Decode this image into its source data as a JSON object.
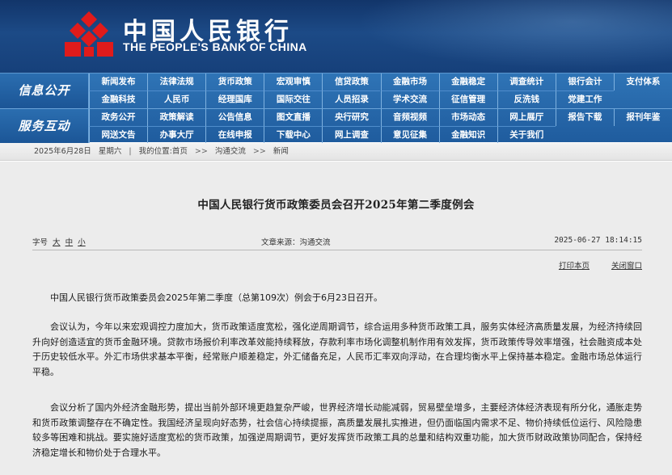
{
  "header": {
    "bank_name_cn": "中国人民银行",
    "bank_name_en": "THE PEOPLE'S BANK OF CHINA",
    "logo_icon": "pboc-emblem-icon",
    "colors": {
      "banner": "#1c4a86",
      "logo_red": "#e01b1b",
      "nav": "#2a69aa"
    }
  },
  "nav": {
    "groups": [
      {
        "title": "信息公开",
        "rows": [
          [
            "新闻发布",
            "法律法规",
            "货币政策",
            "宏观审慎",
            "信贷政策",
            "金融市场",
            "金融稳定",
            "调查统计",
            "银行会计",
            "支付体系"
          ],
          [
            "金融科技",
            "人民币",
            "经理国库",
            "国际交往",
            "人员招录",
            "学术交流",
            "征信管理",
            "反洗钱",
            "党建工作"
          ]
        ]
      },
      {
        "title": "服务互动",
        "rows": [
          [
            "政务公开",
            "政策解读",
            "公告信息",
            "图文直播",
            "央行研究",
            "音频视频",
            "市场动态",
            "网上展厅",
            "报告下载",
            "报刊年鉴"
          ],
          [
            "网送文告",
            "办事大厅",
            "在线申报",
            "下载中心",
            "网上调查",
            "意见征集",
            "金融知识",
            "关于我们"
          ]
        ]
      }
    ]
  },
  "breadcrumb": {
    "date": "2025年6月28日",
    "weekday": "星期六",
    "position_label": "我的位置:首页",
    "items": [
      "沟通交流",
      "新闻"
    ]
  },
  "article": {
    "title": "中国人民银行货币政策委员会召开2025年第二季度例会",
    "font_size_label": "字号",
    "font_sizes": [
      "大",
      "中",
      "小"
    ],
    "source": "文章来源：沟通交流",
    "published": "2025-06-27 18:14:15",
    "print_label": "打印本页",
    "close_label": "关闭窗口",
    "paragraphs": [
      "中国人民银行货币政策委员会2025年第二季度（总第109次）例会于6月23日召开。",
      "会议认为，今年以来宏观调控力度加大，货币政策适度宽松，强化逆周期调节，综合运用多种货币政策工具，服务实体经济高质量发展，为经济持续回升向好创造适宜的货币金融环境。贷款市场报价利率改革效能持续释放，存款利率市场化调整机制作用有效发挥，货币政策传导效率增强，社会融资成本处于历史较低水平。外汇市场供求基本平衡，经常账户顺差稳定，外汇储备充足，人民币汇率双向浮动，在合理均衡水平上保持基本稳定。金融市场总体运行平稳。",
      "会议分析了国内外经济金融形势，提出当前外部环境更趋复杂严峻，世界经济增长动能减弱，贸易壁垒增多，主要经济体经济表现有所分化，通胀走势和货币政策调整存在不确定性。我国经济呈现向好态势，社会信心持续提振，高质量发展扎实推进，但仍面临国内需求不足、物价持续低位运行、风险隐患较多等困难和挑战。要实施好适度宽松的货币政策，加强逆周期调节，更好发挥货币政策工具的总量和结构双重功能，加大货币财政政策协同配合，保持经济稳定增长和物价处于合理水平。"
    ]
  }
}
